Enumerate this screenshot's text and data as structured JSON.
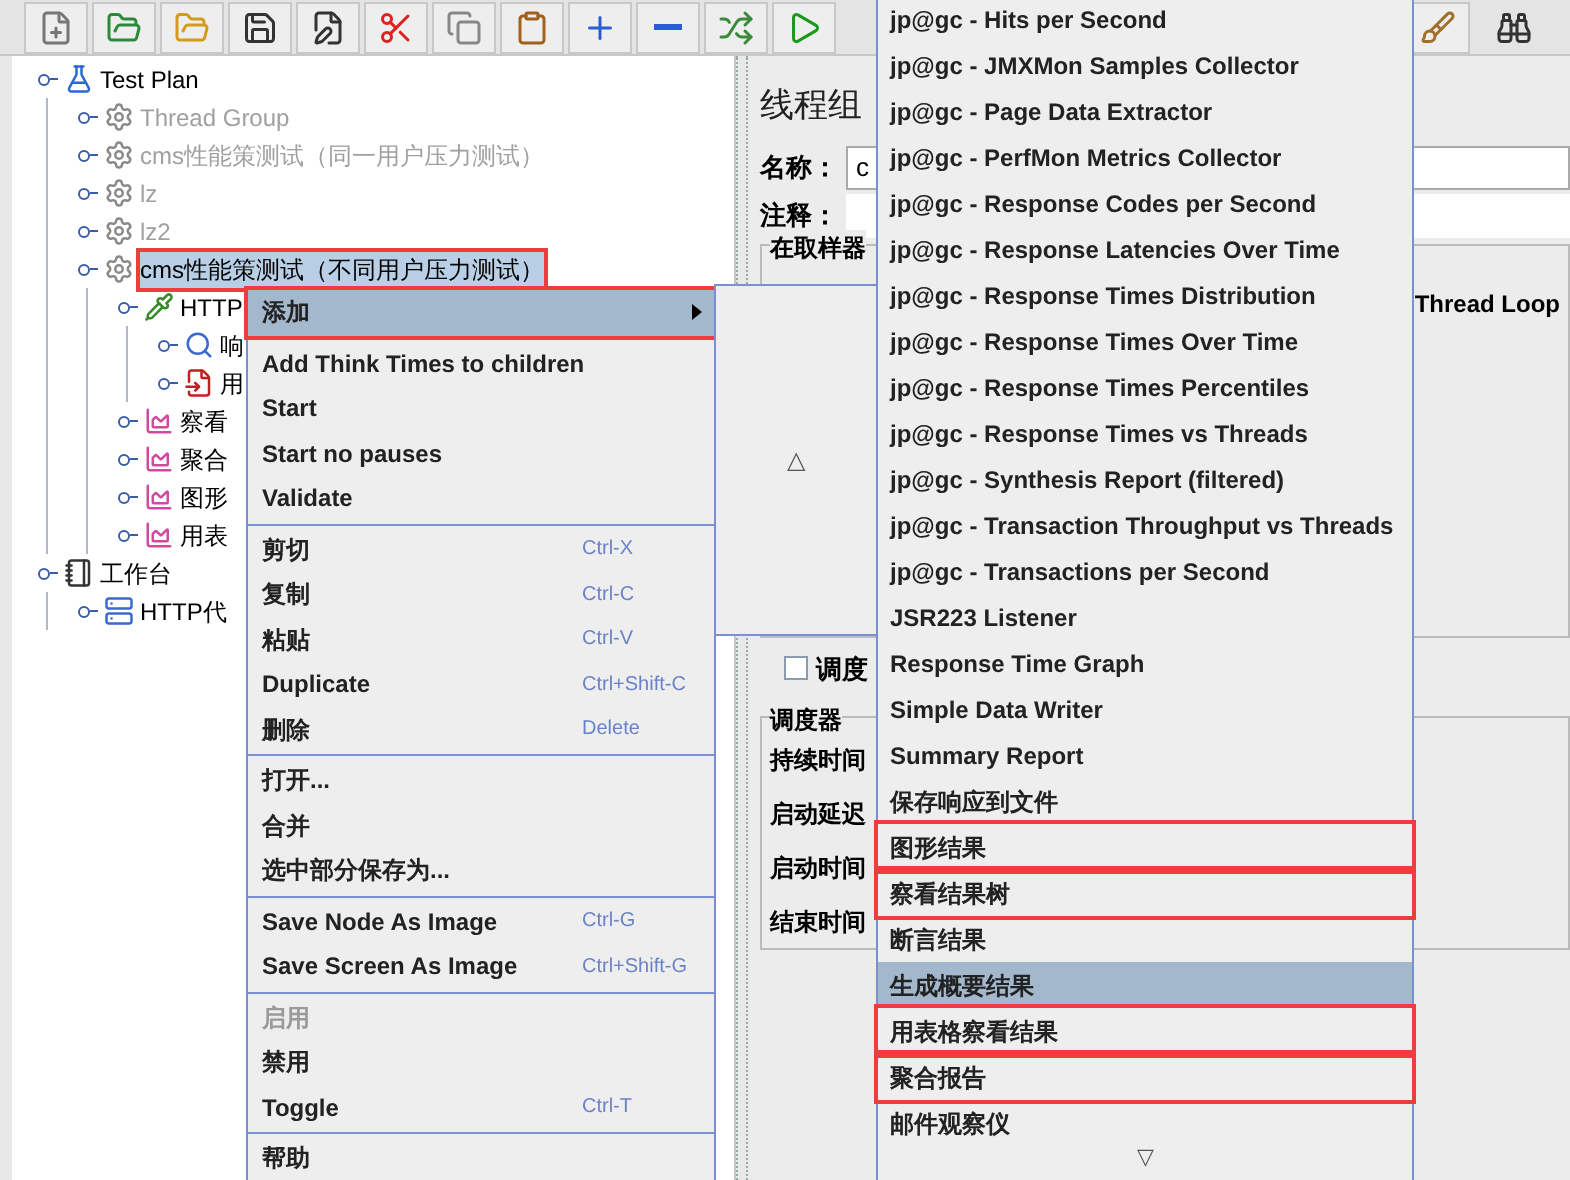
{
  "tree": [
    {
      "label": "Test Plan",
      "kind": "plan",
      "disabled": false,
      "selected": false,
      "framed": false,
      "children": [
        {
          "label": "Thread Group",
          "kind": "group",
          "disabled": true,
          "selected": false,
          "framed": false
        },
        {
          "label": "cms性能策测试（同一用户压力测试）",
          "kind": "group",
          "disabled": true,
          "selected": false,
          "framed": false
        },
        {
          "label": "lz",
          "kind": "group",
          "disabled": true,
          "selected": false,
          "framed": false
        },
        {
          "label": "lz2",
          "kind": "group",
          "disabled": true,
          "selected": false,
          "framed": false
        },
        {
          "label": "cms性能策测试（不同用户压力测试）",
          "kind": "group",
          "disabled": false,
          "selected": true,
          "framed": true,
          "children": [
            {
              "label": "HTTP",
              "kind": "sampler",
              "disabled": false,
              "selected": false,
              "framed": false,
              "children": [
                {
                  "label": "响",
                  "kind": "assertion",
                  "disabled": false,
                  "selected": false,
                  "framed": false
                },
                {
                  "label": "用",
                  "kind": "extractor",
                  "disabled": false,
                  "selected": false,
                  "framed": false
                }
              ]
            },
            {
              "label": "察看",
              "kind": "listener",
              "disabled": false,
              "selected": false,
              "framed": false
            },
            {
              "label": "聚合",
              "kind": "listener",
              "disabled": false,
              "selected": false,
              "framed": false
            },
            {
              "label": "图形",
              "kind": "listener",
              "disabled": false,
              "selected": false,
              "framed": false
            },
            {
              "label": "用表",
              "kind": "listener",
              "disabled": false,
              "selected": false,
              "framed": false
            }
          ]
        }
      ]
    },
    {
      "label": "工作台",
      "kind": "workbench",
      "disabled": false,
      "selected": false,
      "framed": false,
      "children": [
        {
          "label": "HTTP代",
          "kind": "proxy",
          "disabled": false,
          "selected": false,
          "framed": false
        }
      ]
    }
  ],
  "panel": {
    "title": "线程组",
    "name_label": "名称：",
    "name_value": "c",
    "comment_label": "注释：",
    "sampler_group": "在取样器",
    "thread_loop": "Thread Loop",
    "scheduler": {
      "label": "调度",
      "checked": false
    },
    "scheduler_group": "调度器",
    "rows": [
      "持续时间",
      "启动延迟",
      "启动时间",
      "结束时间"
    ]
  },
  "context_menu": [
    {
      "kind": "item",
      "label": "添加",
      "submenu": true,
      "selected": true,
      "disabled": false,
      "framed": true
    },
    {
      "kind": "separator"
    },
    {
      "kind": "item",
      "label": "Add Think Times to children",
      "selected": false,
      "disabled": false,
      "framed": false
    },
    {
      "kind": "item",
      "label": "Start",
      "selected": false,
      "disabled": false,
      "framed": false
    },
    {
      "kind": "item",
      "label": "Start no pauses",
      "selected": false,
      "disabled": false,
      "framed": false
    },
    {
      "kind": "item",
      "label": "Validate",
      "selected": false,
      "disabled": false,
      "framed": false
    },
    {
      "kind": "separator"
    },
    {
      "kind": "item",
      "label": "剪切",
      "shortcut": "Ctrl-X",
      "selected": false,
      "disabled": false,
      "framed": false
    },
    {
      "kind": "item",
      "label": "复制",
      "shortcut": "Ctrl-C",
      "selected": false,
      "disabled": false,
      "framed": false
    },
    {
      "kind": "item",
      "label": "粘贴",
      "shortcut": "Ctrl-V",
      "selected": false,
      "disabled": false,
      "framed": false
    },
    {
      "kind": "item",
      "label": "Duplicate",
      "shortcut": "Ctrl+Shift-C",
      "selected": false,
      "disabled": false,
      "framed": false
    },
    {
      "kind": "item",
      "label": "删除",
      "shortcut": "Delete",
      "selected": false,
      "disabled": false,
      "framed": false
    },
    {
      "kind": "separator"
    },
    {
      "kind": "item",
      "label": "打开...",
      "selected": false,
      "disabled": false,
      "framed": false
    },
    {
      "kind": "item",
      "label": "合并",
      "selected": false,
      "disabled": false,
      "framed": false
    },
    {
      "kind": "item",
      "label": "选中部分保存为...",
      "selected": false,
      "disabled": false,
      "framed": false
    },
    {
      "kind": "separator"
    },
    {
      "kind": "item",
      "label": "Save Node As Image",
      "shortcut": "Ctrl-G",
      "selected": false,
      "disabled": false,
      "framed": false
    },
    {
      "kind": "item",
      "label": "Save Screen As Image",
      "shortcut": "Ctrl+Shift-G",
      "selected": false,
      "disabled": false,
      "framed": false
    },
    {
      "kind": "separator"
    },
    {
      "kind": "item",
      "label": "启用",
      "selected": false,
      "disabled": true,
      "framed": false
    },
    {
      "kind": "item",
      "label": "禁用",
      "selected": false,
      "disabled": false,
      "framed": false
    },
    {
      "kind": "item",
      "label": "Toggle",
      "shortcut": "Ctrl-T",
      "selected": false,
      "disabled": false,
      "framed": false
    },
    {
      "kind": "separator"
    },
    {
      "kind": "item",
      "label": "帮助",
      "selected": false,
      "disabled": false,
      "framed": false
    }
  ],
  "category_menu": {
    "scroll_up": "△"
  },
  "listener_menu": {
    "items": [
      {
        "label": "jp@gc - Hits per Second",
        "selected": false,
        "framed": false
      },
      {
        "label": "jp@gc - JMXMon Samples Collector",
        "selected": false,
        "framed": false
      },
      {
        "label": "jp@gc - Page Data Extractor",
        "selected": false,
        "framed": false
      },
      {
        "label": "jp@gc - PerfMon Metrics Collector",
        "selected": false,
        "framed": false
      },
      {
        "label": "jp@gc - Response Codes per Second",
        "selected": false,
        "framed": false
      },
      {
        "label": "jp@gc - Response Latencies Over Time",
        "selected": false,
        "framed": false
      },
      {
        "label": "jp@gc - Response Times Distribution",
        "selected": false,
        "framed": false
      },
      {
        "label": "jp@gc - Response Times Over Time",
        "selected": false,
        "framed": false
      },
      {
        "label": "jp@gc - Response Times Percentiles",
        "selected": false,
        "framed": false
      },
      {
        "label": "jp@gc - Response Times vs Threads",
        "selected": false,
        "framed": false
      },
      {
        "label": "jp@gc - Synthesis Report (filtered)",
        "selected": false,
        "framed": false
      },
      {
        "label": "jp@gc - Transaction Throughput vs Threads",
        "selected": false,
        "framed": false
      },
      {
        "label": "jp@gc - Transactions per Second",
        "selected": false,
        "framed": false
      },
      {
        "label": "JSR223 Listener",
        "selected": false,
        "framed": false
      },
      {
        "label": "Response Time Graph",
        "selected": false,
        "framed": false
      },
      {
        "label": "Simple Data Writer",
        "selected": false,
        "framed": false
      },
      {
        "label": "Summary Report",
        "selected": false,
        "framed": false
      },
      {
        "label": "保存响应到文件",
        "selected": false,
        "framed": false
      },
      {
        "label": "图形结果",
        "selected": false,
        "framed": true
      },
      {
        "label": "察看结果树",
        "selected": false,
        "framed": true
      },
      {
        "label": "断言结果",
        "selected": false,
        "framed": false
      },
      {
        "label": "生成概要结果",
        "selected": true,
        "framed": false
      },
      {
        "label": "用表格察看结果",
        "selected": false,
        "framed": true
      },
      {
        "label": "聚合报告",
        "selected": false,
        "framed": true
      },
      {
        "label": "邮件观察仪",
        "selected": false,
        "framed": false
      }
    ],
    "scroll_down": "▽"
  }
}
